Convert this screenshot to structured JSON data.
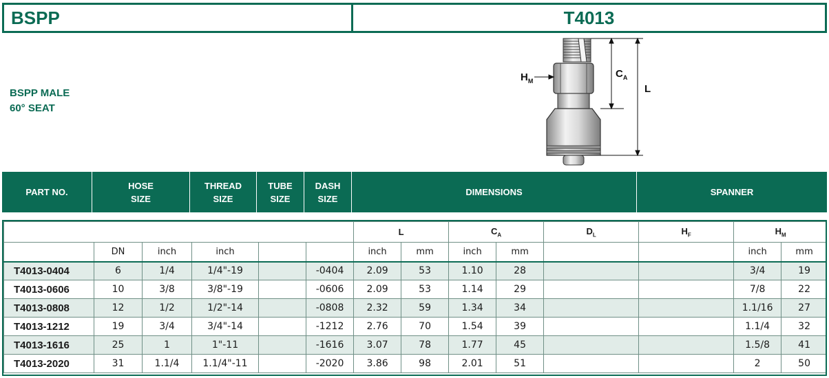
{
  "header": {
    "left_title": "BSPP",
    "right_title": "T4013"
  },
  "description": {
    "line1": "BSPP MALE",
    "line2": "60° SEAT"
  },
  "drawing": {
    "label_hm": "H",
    "label_hm_sub": "M",
    "label_ca": "C",
    "label_ca_sub": "A",
    "label_l": "L"
  },
  "table_header": {
    "part_no": "PART NO.",
    "hose_size_1": "HOSE",
    "hose_size_2": "SIZE",
    "thread_size_1": "THREAD",
    "thread_size_2": "SIZE",
    "tube_size_1": "TUBE",
    "tube_size_2": "SIZE",
    "dash_size_1": "DASH",
    "dash_size_2": "SIZE",
    "dimensions": "DIMENSIONS",
    "spanner": "SPANNER"
  },
  "subheader": {
    "L": "L",
    "CA": "C",
    "CA_sub": "A",
    "DL": "D",
    "DL_sub": "L",
    "HF": "H",
    "HF_sub": "F",
    "HM": "H",
    "HM_sub": "M",
    "dn": "DN",
    "inch_hose": "inch",
    "inch_thread": "inch",
    "L_inch": "inch",
    "L_mm": "mm",
    "CA_inch": "inch",
    "CA_mm": "mm",
    "HM_inch": "inch",
    "HM_mm": "mm"
  },
  "rows": [
    {
      "part": "T4013-0404",
      "dn": "6",
      "inch": "1/4",
      "thread": "1/4\"-19",
      "tube": "",
      "dash": "-0404",
      "l_in": "2.09",
      "l_mm": "53",
      "ca_in": "1.10",
      "ca_mm": "28",
      "dl": "",
      "hf": "",
      "hm_in": "3/4",
      "hm_mm": "19"
    },
    {
      "part": "T4013-0606",
      "dn": "10",
      "inch": "3/8",
      "thread": "3/8\"-19",
      "tube": "",
      "dash": "-0606",
      "l_in": "2.09",
      "l_mm": "53",
      "ca_in": "1.14",
      "ca_mm": "29",
      "dl": "",
      "hf": "",
      "hm_in": "7/8",
      "hm_mm": "22"
    },
    {
      "part": "T4013-0808",
      "dn": "12",
      "inch": "1/2",
      "thread": "1/2\"-14",
      "tube": "",
      "dash": "-0808",
      "l_in": "2.32",
      "l_mm": "59",
      "ca_in": "1.34",
      "ca_mm": "34",
      "dl": "",
      "hf": "",
      "hm_in": "1.1/16",
      "hm_mm": "27"
    },
    {
      "part": "T4013-1212",
      "dn": "19",
      "inch": "3/4",
      "thread": "3/4\"-14",
      "tube": "",
      "dash": "-1212",
      "l_in": "2.76",
      "l_mm": "70",
      "ca_in": "1.54",
      "ca_mm": "39",
      "dl": "",
      "hf": "",
      "hm_in": "1.1/4",
      "hm_mm": "32"
    },
    {
      "part": "T4013-1616",
      "dn": "25",
      "inch": "1",
      "thread": "1\"-11",
      "tube": "",
      "dash": "-1616",
      "l_in": "3.07",
      "l_mm": "78",
      "ca_in": "1.77",
      "ca_mm": "45",
      "dl": "",
      "hf": "",
      "hm_in": "1.5/8",
      "hm_mm": "41"
    },
    {
      "part": "T4013-2020",
      "dn": "31",
      "inch": "1.1/4",
      "thread": "1.1/4\"-11",
      "tube": "",
      "dash": "-2020",
      "l_in": "3.86",
      "l_mm": "98",
      "ca_in": "2.01",
      "ca_mm": "51",
      "dl": "",
      "hf": "",
      "hm_in": "2",
      "hm_mm": "50"
    }
  ],
  "colors": {
    "brand_green": "#0b6b54",
    "row_shade": "#e1ece8"
  }
}
